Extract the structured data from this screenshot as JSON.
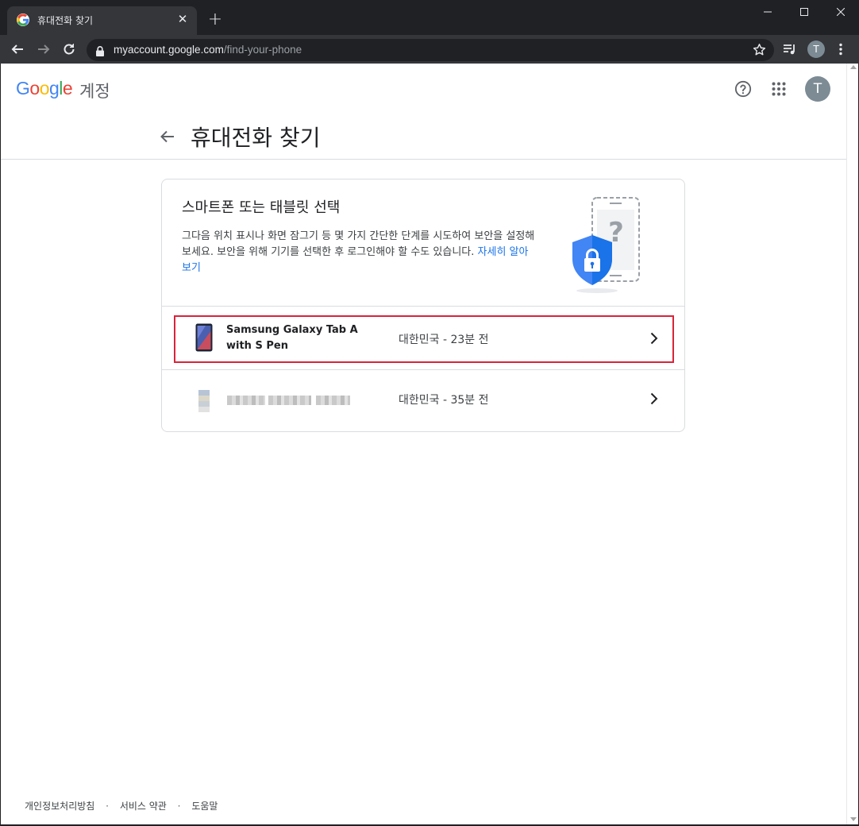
{
  "browser": {
    "tab_title": "휴대전화 찾기",
    "tab_close": "✕",
    "new_tab": "+",
    "url_host": "myaccount.google.com",
    "url_path": "/find-your-phone",
    "profile_initial": "T"
  },
  "header": {
    "logo_letters": [
      "G",
      "o",
      "o",
      "g",
      "l",
      "e"
    ],
    "product": "계정",
    "avatar_initial": "T"
  },
  "page": {
    "title": "휴대전화 찾기"
  },
  "card": {
    "title": "스마트폰 또는 태블릿 선택",
    "description": "그다음 위치 표시나 화면 잠그기 등 몇 가지 간단한 단계를 시도하여 보안을 설정해 보세요. 보안을 위해 기기를 선택한 후 로그인해야 할 수도 있습니다.",
    "learn_more": "자세히 알아보기"
  },
  "devices": [
    {
      "name": "Samsung Galaxy Tab A with S Pen",
      "location": "대한민국 - 23분 전",
      "selected": true
    },
    {
      "name": "",
      "location": "대한민국 - 35분 전",
      "selected": false
    }
  ],
  "footer": {
    "privacy": "개인정보처리방침",
    "terms": "서비스 약관",
    "help": "도움말",
    "separator": "·"
  },
  "colors": {
    "accent": "#1a73e8",
    "selection_border": "#d9243a",
    "shield": "#1a73e8"
  }
}
